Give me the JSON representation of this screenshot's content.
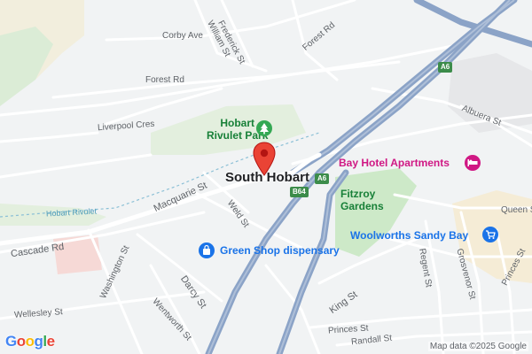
{
  "map": {
    "suburb": "South Hobart",
    "parks": [
      "Hobart Rivulet Park",
      "Fitzroy Gardens"
    ],
    "parks_line1": "Hobart",
    "parks_line2": "Rivulet Park",
    "fitzroy_line1": "Fitzroy",
    "fitzroy_line2": "Gardens",
    "water": "Hobart Rivulet",
    "streets": {
      "corby": "Corby Ave",
      "frederick": "Frederick St",
      "william": "William St",
      "forest_top": "Forest Rd",
      "forest_mid": "Forest Rd",
      "liverpool": "Liverpool Cres",
      "albuera": "Albuera St",
      "macquarie": "Macquarie St",
      "weld": "Weld St",
      "cascade": "Cascade Rd",
      "washington": "Washington St",
      "darcy": "Darcy St",
      "wentworth": "Wentworth St",
      "wellesley": "Wellesley St",
      "king": "King St",
      "regent": "Regent St",
      "grosvenor": "Grosvenor St",
      "princes_a": "Princes St",
      "princes_b": "Princes St",
      "randall": "Randall St",
      "queen": "Queen S"
    },
    "routes": {
      "a6_top": "A6",
      "a6_mid": "A6",
      "b64": "B64"
    },
    "pois": {
      "hotel": "Bay Hotel Apartments",
      "shop": "Green Shop dispensary",
      "woolworths": "Woolworths Sandy Bay"
    },
    "attribution": "Map data ©2025 Google",
    "logo": "Google",
    "icons": [
      "location-pin-icon",
      "park-tree-icon",
      "hotel-bed-icon",
      "shopping-bag-icon",
      "shopping-cart-icon"
    ],
    "colors": {
      "background": "#f1f3f4",
      "park": "#cde9c8",
      "highway": "#8ba3c7",
      "road": "#ffffff",
      "pin": "#ea4335",
      "hotel": "#d01884",
      "poi_blue": "#1a73e8",
      "park_text": "#188038"
    }
  }
}
